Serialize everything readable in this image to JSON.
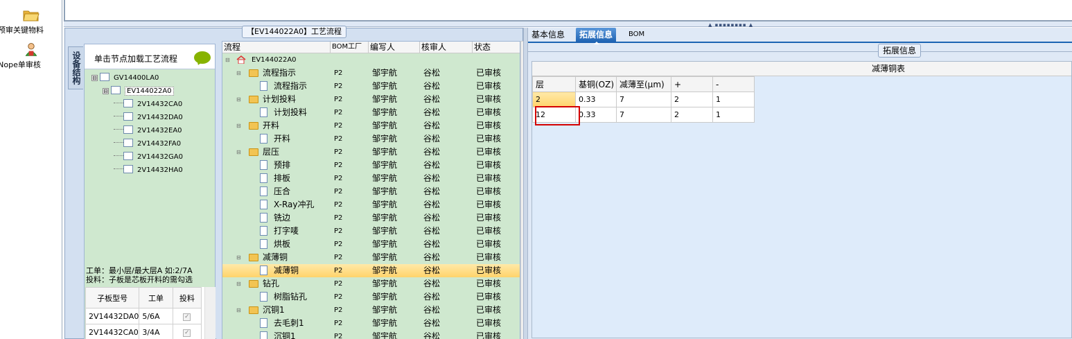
{
  "launch": [
    {
      "label": "预审关键物料",
      "icon": "folder-open-icon"
    },
    {
      "label": "Nope单审核",
      "icon": "user-icon"
    }
  ],
  "process_panel": {
    "title": "【EV144022A0】工艺流程",
    "side_tab": "设备结构",
    "hint": "单击节点加载工艺流程",
    "tree": [
      {
        "label": "GV14400LA0",
        "level": 0,
        "expander": "⊟"
      },
      {
        "label": "EV144022A0",
        "level": 1,
        "expander": "⊟",
        "selected": true
      },
      {
        "label": "2V14432CA0",
        "level": 2
      },
      {
        "label": "2V14432DA0",
        "level": 2
      },
      {
        "label": "2V14432EA0",
        "level": 2
      },
      {
        "label": "2V14432FA0",
        "level": 2
      },
      {
        "label": "2V14432GA0",
        "level": 2
      },
      {
        "label": "2V14432HA0",
        "level": 2
      }
    ],
    "note_line1": "工单：最小层/最大层A 如:2/7A",
    "note_line2": "投料：子板是芯板开料的需勾选",
    "sub_grid": {
      "headers": [
        "子板型号",
        "工单",
        "投料"
      ],
      "rows": [
        [
          "2V14432DA0",
          "5/6A",
          "✓"
        ],
        [
          "2V14432CA0",
          "3/4A",
          "✓"
        ]
      ]
    }
  },
  "process_grid": {
    "headers": [
      "流程",
      "BOM工厂",
      "编写人",
      "核审人",
      "状态"
    ],
    "root": "EV144022A0",
    "rows": [
      {
        "name": "流程指示",
        "kind": "folder",
        "bom": "P2",
        "writer": "邹宇航",
        "reviewer": "谷松",
        "status": "已审核"
      },
      {
        "name": "流程指示",
        "kind": "doc",
        "bom": "P2",
        "writer": "邹宇航",
        "reviewer": "谷松",
        "status": "已审核"
      },
      {
        "name": "计划投料",
        "kind": "folder",
        "bom": "P2",
        "writer": "邹宇航",
        "reviewer": "谷松",
        "status": "已审核"
      },
      {
        "name": "计划投料",
        "kind": "doc",
        "bom": "P2",
        "writer": "邹宇航",
        "reviewer": "谷松",
        "status": "已审核"
      },
      {
        "name": "开料",
        "kind": "folder",
        "bom": "P2",
        "writer": "邹宇航",
        "reviewer": "谷松",
        "status": "已审核"
      },
      {
        "name": "开料",
        "kind": "doc",
        "bom": "P2",
        "writer": "邹宇航",
        "reviewer": "谷松",
        "status": "已审核"
      },
      {
        "name": "层压",
        "kind": "folder",
        "bom": "P2",
        "writer": "邹宇航",
        "reviewer": "谷松",
        "status": "已审核"
      },
      {
        "name": "预排",
        "kind": "doc",
        "bom": "P2",
        "writer": "邹宇航",
        "reviewer": "谷松",
        "status": "已审核"
      },
      {
        "name": "排板",
        "kind": "doc",
        "bom": "P2",
        "writer": "邹宇航",
        "reviewer": "谷松",
        "status": "已审核"
      },
      {
        "name": "压合",
        "kind": "doc",
        "bom": "P2",
        "writer": "邹宇航",
        "reviewer": "谷松",
        "status": "已审核"
      },
      {
        "name": "X-Ray冲孔",
        "kind": "doc",
        "bom": "P2",
        "writer": "邹宇航",
        "reviewer": "谷松",
        "status": "已审核"
      },
      {
        "name": "铣边",
        "kind": "doc",
        "bom": "P2",
        "writer": "邹宇航",
        "reviewer": "谷松",
        "status": "已审核"
      },
      {
        "name": "打字唛",
        "kind": "doc",
        "bom": "P2",
        "writer": "邹宇航",
        "reviewer": "谷松",
        "status": "已审核"
      },
      {
        "name": "烘板",
        "kind": "doc",
        "bom": "P2",
        "writer": "邹宇航",
        "reviewer": "谷松",
        "status": "已审核"
      },
      {
        "name": "减薄铜",
        "kind": "folder",
        "bom": "P2",
        "writer": "邹宇航",
        "reviewer": "谷松",
        "status": "已审核"
      },
      {
        "name": "减薄铜",
        "kind": "doc",
        "bom": "P2",
        "writer": "邹宇航",
        "reviewer": "谷松",
        "status": "已审核",
        "selected": true
      },
      {
        "name": "钻孔",
        "kind": "folder",
        "bom": "P2",
        "writer": "邹宇航",
        "reviewer": "谷松",
        "status": "已审核"
      },
      {
        "name": "树脂钻孔",
        "kind": "doc",
        "bom": "P2",
        "writer": "邹宇航",
        "reviewer": "谷松",
        "status": "已审核"
      },
      {
        "name": "沉铜1",
        "kind": "folder",
        "bom": "P2",
        "writer": "邹宇航",
        "reviewer": "谷松",
        "status": "已审核"
      },
      {
        "name": "去毛刺1",
        "kind": "doc",
        "bom": "P2",
        "writer": "邹宇航",
        "reviewer": "谷松",
        "status": "已审核"
      },
      {
        "name": "沉铜1",
        "kind": "doc",
        "bom": "P2",
        "writer": "邹宇航",
        "reviewer": "谷松",
        "status": "已审核"
      }
    ]
  },
  "right_panel": {
    "tabs": [
      "基本信息",
      "拓展信息",
      "BOM"
    ],
    "active_tab": "拓展信息",
    "section_title": "拓展信息",
    "table_title": "减薄铜表",
    "table": {
      "headers": [
        "层",
        "基铜(OZ)",
        "减薄至(μm)",
        "+",
        "-"
      ],
      "rows": [
        [
          "2",
          "0.33",
          "7",
          "2",
          "1"
        ],
        [
          "12",
          "0.33",
          "7",
          "2",
          "1"
        ]
      ]
    }
  },
  "colors": {
    "tree_bg": "#cfe8cf",
    "panel_bg": "#d3e0f1",
    "active_tab": "#1a5fb0",
    "highlight": "#ffd36b",
    "red_box": "#d40000"
  }
}
